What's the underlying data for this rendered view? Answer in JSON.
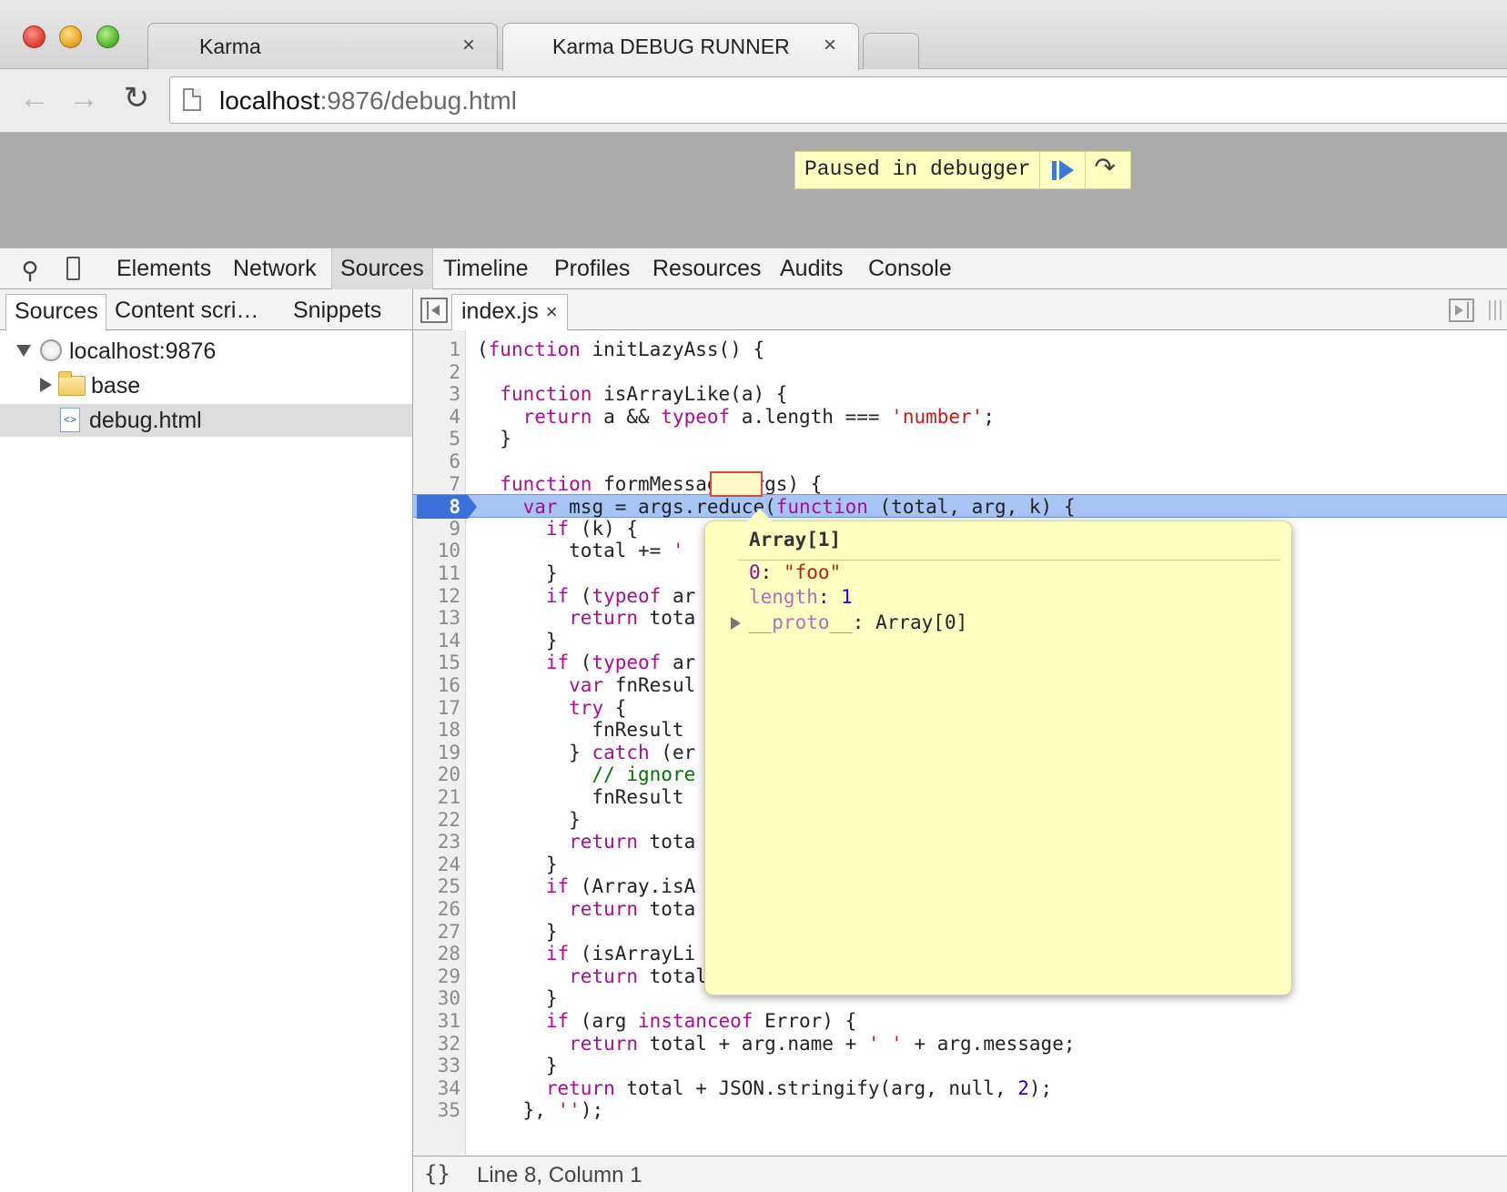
{
  "browser": {
    "tabs": [
      {
        "title": "Karma",
        "close": "×"
      },
      {
        "title": "Karma DEBUG RUNNER",
        "close": "×"
      }
    ],
    "url_host": "localhost",
    "url_rest": ":9876/debug.html"
  },
  "page": {
    "paused_message": "Paused in debugger"
  },
  "devtools": {
    "tabs": [
      "Elements",
      "Network",
      "Sources",
      "Timeline",
      "Profiles",
      "Resources",
      "Audits",
      "Console"
    ],
    "selected_tab": "Sources",
    "navigator": {
      "tabs": [
        "Sources",
        "Content scri…",
        "Snippets"
      ],
      "tree": [
        {
          "label": "localhost:9876"
        },
        {
          "label": "base"
        },
        {
          "label": "debug.html"
        }
      ]
    },
    "editor": {
      "file_tab": "index.js",
      "file_close": "×",
      "execution_line": 8,
      "lines": [
        {
          "n": "1",
          "text": "(function initLazyAss() {"
        },
        {
          "n": "2",
          "text": ""
        },
        {
          "n": "3",
          "text": "  function isArrayLike(a) {"
        },
        {
          "n": "4",
          "text": "    return a && typeof a.length === 'number';"
        },
        {
          "n": "5",
          "text": "  }"
        },
        {
          "n": "6",
          "text": ""
        },
        {
          "n": "7",
          "text": "  function formMessage(args) {"
        },
        {
          "n": "8",
          "text": "    var msg = args.reduce(function (total, arg, k) {"
        },
        {
          "n": "9",
          "text": "      if (k) {"
        },
        {
          "n": "10",
          "text": "        total += '"
        },
        {
          "n": "11",
          "text": "      }"
        },
        {
          "n": "12",
          "text": "      if (typeof ar"
        },
        {
          "n": "13",
          "text": "        return tota"
        },
        {
          "n": "14",
          "text": "      }"
        },
        {
          "n": "15",
          "text": "      if (typeof ar"
        },
        {
          "n": "16",
          "text": "        var fnResul"
        },
        {
          "n": "17",
          "text": "        try {"
        },
        {
          "n": "18",
          "text": "          fnResult"
        },
        {
          "n": "19",
          "text": "        } catch (er"
        },
        {
          "n": "20",
          "text": "          // ignore"
        },
        {
          "n": "21",
          "text": "          fnResult"
        },
        {
          "n": "22",
          "text": "        }"
        },
        {
          "n": "23",
          "text": "        return tota"
        },
        {
          "n": "24",
          "text": "      }"
        },
        {
          "n": "25",
          "text": "      if (Array.isA"
        },
        {
          "n": "26",
          "text": "        return tota"
        },
        {
          "n": "27",
          "text": "      }"
        },
        {
          "n": "28",
          "text": "      if (isArrayLi"
        },
        {
          "n": "29",
          "text": "        return total + JSON.stringify(Array.prototype.slice.call(arg));"
        },
        {
          "n": "30",
          "text": "      }"
        },
        {
          "n": "31",
          "text": "      if (arg instanceof Error) {"
        },
        {
          "n": "32",
          "text": "        return total + arg.name + ' ' + arg.message;"
        },
        {
          "n": "33",
          "text": "      }"
        },
        {
          "n": "34",
          "text": "      return total + JSON.stringify(arg, null, 2);"
        },
        {
          "n": "35",
          "text": "    }, '');"
        }
      ],
      "status_pretty_print": "{}",
      "status_position": "Line 8, Column 1"
    },
    "popover": {
      "title": "Array[1]",
      "properties": [
        {
          "key": "0",
          "value": "\"foo\""
        },
        {
          "key": "length",
          "value": "1"
        },
        {
          "key": "__proto__",
          "value": "Array[0]"
        }
      ]
    }
  }
}
